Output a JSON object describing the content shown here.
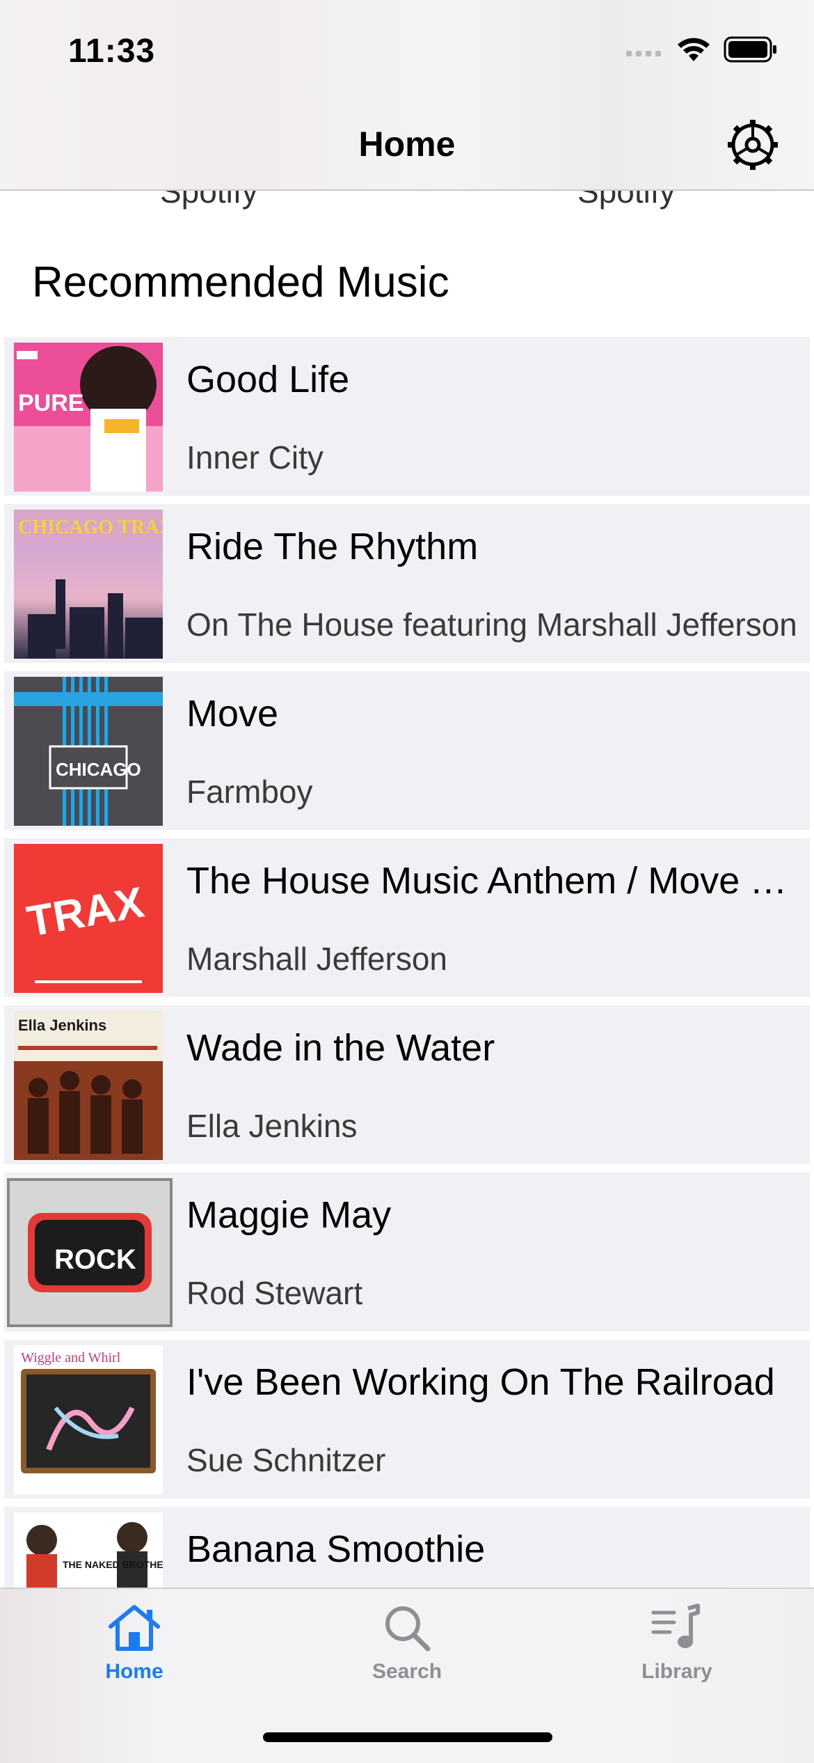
{
  "status": {
    "time": "11:33"
  },
  "nav": {
    "title": "Home"
  },
  "top_cut_labels": [
    "Spotify",
    "Spotify"
  ],
  "section": {
    "title": "Recommended Music"
  },
  "songs": [
    {
      "title": "Good Life",
      "artist": "Inner City",
      "art_name": "pure-80s-pop-album-art",
      "art_colors": [
        "#e63c8a",
        "#f6b7d2"
      ]
    },
    {
      "title": "Ride The Rhythm",
      "artist": "On The House featuring Marshall Jefferson",
      "art_name": "chicago-trax-album-art",
      "art_colors": [
        "#c9a9d6",
        "#2a2a44"
      ]
    },
    {
      "title": "Move",
      "artist": "Farmboy",
      "art_name": "house-sound-of-chicago-album-art",
      "art_colors": [
        "#4a474d",
        "#2aa6e0"
      ]
    },
    {
      "title": "The House Music Anthem / Move Y...",
      "artist": "Marshall Jefferson",
      "art_name": "trax-records-album-art",
      "art_colors": [
        "#f23b36",
        "#ffffff"
      ]
    },
    {
      "title": "Wade in the Water",
      "artist": "Ella Jenkins",
      "art_name": "ella-jenkins-album-art",
      "art_colors": [
        "#f4efe0",
        "#8b3a1e"
      ]
    },
    {
      "title": "Maggie May",
      "artist": "Rod Stewart",
      "art_name": "classic-rock-album-art",
      "art_colors": [
        "#d9d9d9",
        "#222222"
      ]
    },
    {
      "title": "I've Been Working On The Railroad",
      "artist": "Sue Schnitzer",
      "art_name": "wiggle-and-whirl-album-art",
      "art_colors": [
        "#ffffff",
        "#2a2a2a"
      ]
    },
    {
      "title": "Banana Smoothie",
      "artist": "",
      "art_name": "naked-brothers-band-album-art",
      "art_colors": [
        "#ffffff",
        "#333333"
      ]
    }
  ],
  "art_text": {
    "0": "PURE",
    "1": "CHICAGO TRAX",
    "2": "CHICAGO",
    "3": "TRAX",
    "4": "Ella Jenkins",
    "5": "ROCK",
    "6": "Wiggle and Whirl",
    "7": "THE NAKED BROTHERS BAND"
  },
  "tabs": [
    {
      "label": "Home",
      "icon": "house-icon",
      "active": true
    },
    {
      "label": "Search",
      "icon": "magnifier-icon",
      "active": false
    },
    {
      "label": "Library",
      "icon": "music-library-icon",
      "active": false
    }
  ],
  "colors": {
    "accent": "#1a7cf0",
    "inactive": "#8e8e93",
    "row_bg": "#f1f1f5"
  }
}
